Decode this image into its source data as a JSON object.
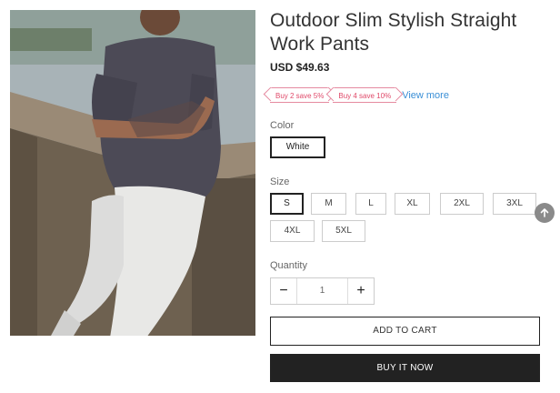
{
  "product": {
    "title": "Outdoor Slim Stylish Straight Work Pants",
    "price": "USD $49.63",
    "image_alt": "model-photo",
    "promos": [
      "Buy 2 save 5%",
      "Buy 4 save 10%"
    ],
    "view_more": "View more"
  },
  "options": {
    "color_label": "Color",
    "color_selected": "White",
    "size_label": "Size",
    "sizes": [
      "S",
      "M",
      "L",
      "XL",
      "2XL",
      "3XL",
      "4XL",
      "5XL"
    ],
    "size_selected": "S"
  },
  "quantity": {
    "label": "Quantity",
    "value": "1",
    "minus": "−",
    "plus": "+"
  },
  "actions": {
    "add_to_cart": "ADD TO CART",
    "buy_it_now": "BUY IT NOW"
  },
  "icons": {
    "scroll_top": "arrow-up-icon"
  }
}
